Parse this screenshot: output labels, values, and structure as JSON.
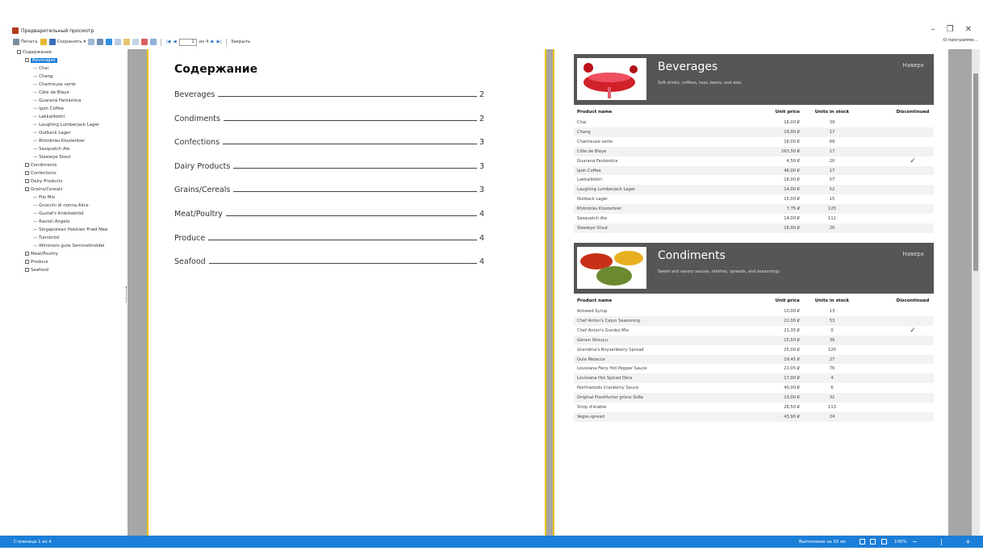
{
  "window": {
    "title": "Предварительный просмотр",
    "controls": [
      "–",
      "❐",
      "✕"
    ]
  },
  "toolbar": {
    "print_label": "Печать",
    "save_label": "Сохранить",
    "page_value": "1",
    "of_label": "из 4",
    "close_label": "Закрыть",
    "about_label": "О программе..."
  },
  "tree": {
    "root": "Содержание",
    "groups": [
      {
        "label": "Beverages",
        "selected": true,
        "children": [
          "Chai",
          "Chang",
          "Chartreuse verte",
          "Côte de Blaye",
          "Guaraná Fantástica",
          "Ipoh Coffee",
          "Lakkalikööri",
          "Laughing Lumberjack Lager",
          "Outback Lager",
          "Rhönbräu Klosterbier",
          "Sasquatch Ale",
          "Steeleye Stout"
        ]
      },
      {
        "label": "Condiments",
        "children": []
      },
      {
        "label": "Confections",
        "children": []
      },
      {
        "label": "Dairy Products",
        "children": []
      },
      {
        "label": "Grains/Cereals",
        "children": [
          "Filo Mix",
          "Gnocchi di nonna Alice",
          "Gustaf's Knäckebröd",
          "Ravioli Angelo",
          "Singaporean Hokkien Fried Mee",
          "Tunnbröd",
          "Wimmers gute Semmelknödel"
        ]
      },
      {
        "label": "Meat/Poultry",
        "children": []
      },
      {
        "label": "Produce",
        "children": []
      },
      {
        "label": "Seafood",
        "children": []
      }
    ]
  },
  "toc": {
    "title": "Содержание",
    "entries": [
      {
        "name": "Beverages",
        "page": "2"
      },
      {
        "name": "Condiments",
        "page": "2"
      },
      {
        "name": "Confections",
        "page": "3"
      },
      {
        "name": "Dairy Products",
        "page": "3"
      },
      {
        "name": "Grains/Cereals",
        "page": "3"
      },
      {
        "name": "Meat/Poultry",
        "page": "4"
      },
      {
        "name": "Produce",
        "page": "4"
      },
      {
        "name": "Seafood",
        "page": "4"
      }
    ]
  },
  "report": {
    "up_label": "Наверх",
    "headers": {
      "name": "Product name",
      "price": "Unit price",
      "stock": "Units in stock",
      "disc": "Discontinued"
    },
    "categories": [
      {
        "name": "Beverages",
        "description": "Soft drinks, coffees, teas, beers, and ales",
        "products": [
          {
            "name": "Chai",
            "price": "18,00 ₽",
            "stock": "39",
            "disc": false
          },
          {
            "name": "Chang",
            "price": "19,00 ₽",
            "stock": "17",
            "disc": false
          },
          {
            "name": "Chartreuse verte",
            "price": "18,00 ₽",
            "stock": "69",
            "disc": false
          },
          {
            "name": "Côte de Blaye",
            "price": "263,50 ₽",
            "stock": "17",
            "disc": false
          },
          {
            "name": "Guaraná Fantástica",
            "price": "4,50 ₽",
            "stock": "20",
            "disc": true
          },
          {
            "name": "Ipoh Coffee",
            "price": "46,00 ₽",
            "stock": "17",
            "disc": false
          },
          {
            "name": "Lakkalikööri",
            "price": "18,00 ₽",
            "stock": "57",
            "disc": false
          },
          {
            "name": "Laughing Lumberjack Lager",
            "price": "14,00 ₽",
            "stock": "52",
            "disc": false
          },
          {
            "name": "Outback Lager",
            "price": "15,00 ₽",
            "stock": "15",
            "disc": false
          },
          {
            "name": "Rhönbräu Klosterbier",
            "price": "7,75 ₽",
            "stock": "125",
            "disc": false
          },
          {
            "name": "Sasquatch Ale",
            "price": "14,00 ₽",
            "stock": "111",
            "disc": false
          },
          {
            "name": "Steeleye Stout",
            "price": "18,00 ₽",
            "stock": "20",
            "disc": false
          }
        ]
      },
      {
        "name": "Condiments",
        "description": "Sweet and savory sauces, relishes, spreads, and seasonings",
        "products": [
          {
            "name": "Aniseed Syrup",
            "price": "10,00 ₽",
            "stock": "13",
            "disc": false
          },
          {
            "name": "Chef Anton's Cajun Seasoning",
            "price": "22,00 ₽",
            "stock": "53",
            "disc": false
          },
          {
            "name": "Chef Anton's Gumbo Mix",
            "price": "21,35 ₽",
            "stock": "0",
            "disc": true
          },
          {
            "name": "Genen Shouyu",
            "price": "15,50 ₽",
            "stock": "39",
            "disc": false
          },
          {
            "name": "Grandma's Boysenberry Spread",
            "price": "25,00 ₽",
            "stock": "120",
            "disc": false
          },
          {
            "name": "Gula Malacca",
            "price": "19,45 ₽",
            "stock": "27",
            "disc": false
          },
          {
            "name": "Louisiana Fiery Hot Pepper Sauce",
            "price": "21,05 ₽",
            "stock": "76",
            "disc": false
          },
          {
            "name": "Louisiana Hot Spiced Okra",
            "price": "17,00 ₽",
            "stock": "4",
            "disc": false
          },
          {
            "name": "Northwoods Cranberry Sauce",
            "price": "40,00 ₽",
            "stock": "6",
            "disc": false
          },
          {
            "name": "Original Frankfurter grüne Soße",
            "price": "13,00 ₽",
            "stock": "32",
            "disc": false
          },
          {
            "name": "Sirop d'érable",
            "price": "28,50 ₽",
            "stock": "113",
            "disc": false
          },
          {
            "name": "Vegie-spread",
            "price": "43,90 ₽",
            "stock": "24",
            "disc": false
          }
        ]
      }
    ]
  },
  "statusbar": {
    "page_info": "Страница 1 из 4",
    "exec_time": "Выполнено за 32 мс",
    "zoom": "100%"
  },
  "colors": {
    "accent": "#1b7fd8",
    "page_border": "#f2c100",
    "category_header": "#565656"
  }
}
